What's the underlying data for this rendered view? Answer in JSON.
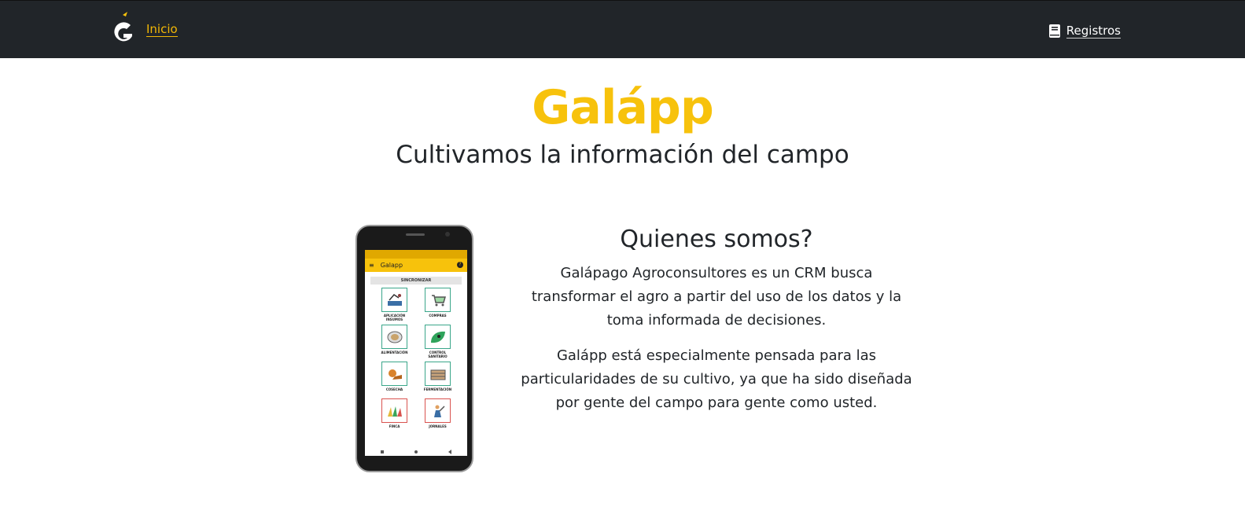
{
  "nav": {
    "home_label": "Inicio",
    "records_label": "Registros",
    "records_icon": "book-icon",
    "logo_icon": "galapp-logo-icon",
    "background_color": "#212529",
    "accent_color": "#f7c20c"
  },
  "hero": {
    "title": "Galápp",
    "tagline": "Cultivamos la información del campo"
  },
  "about": {
    "heading": "Quienes somos?",
    "paragraphs": [
      "Galápago Agroconsultores es un CRM busca transformar el agro a partir del uso de los datos y la toma informada de decisiones.",
      "Galápp está especialmente pensada para las particularidades de su cultivo, ya que ha sido diseñada por gente del campo para gente como usted."
    ]
  },
  "phone_app": {
    "app_title": "Galapp",
    "sync_label": "SINCRONIZAR",
    "tiles": [
      {
        "label": "APLICACIÓN INSUMOS",
        "icon": "sprayer-icon"
      },
      {
        "label": "COMPRAS",
        "icon": "cart-icon"
      },
      {
        "label": "ALIMENTACIÓN",
        "icon": "plate-icon"
      },
      {
        "label": "CONTROL SANITARIO",
        "icon": "leaf-icon"
      },
      {
        "label": "COSECHA",
        "icon": "harvest-icon"
      },
      {
        "label": "FERMENTACIÓN",
        "icon": "crate-icon"
      },
      {
        "label": "FINCA",
        "icon": "farm-icon"
      },
      {
        "label": "JORNALES",
        "icon": "worker-icon"
      }
    ]
  }
}
